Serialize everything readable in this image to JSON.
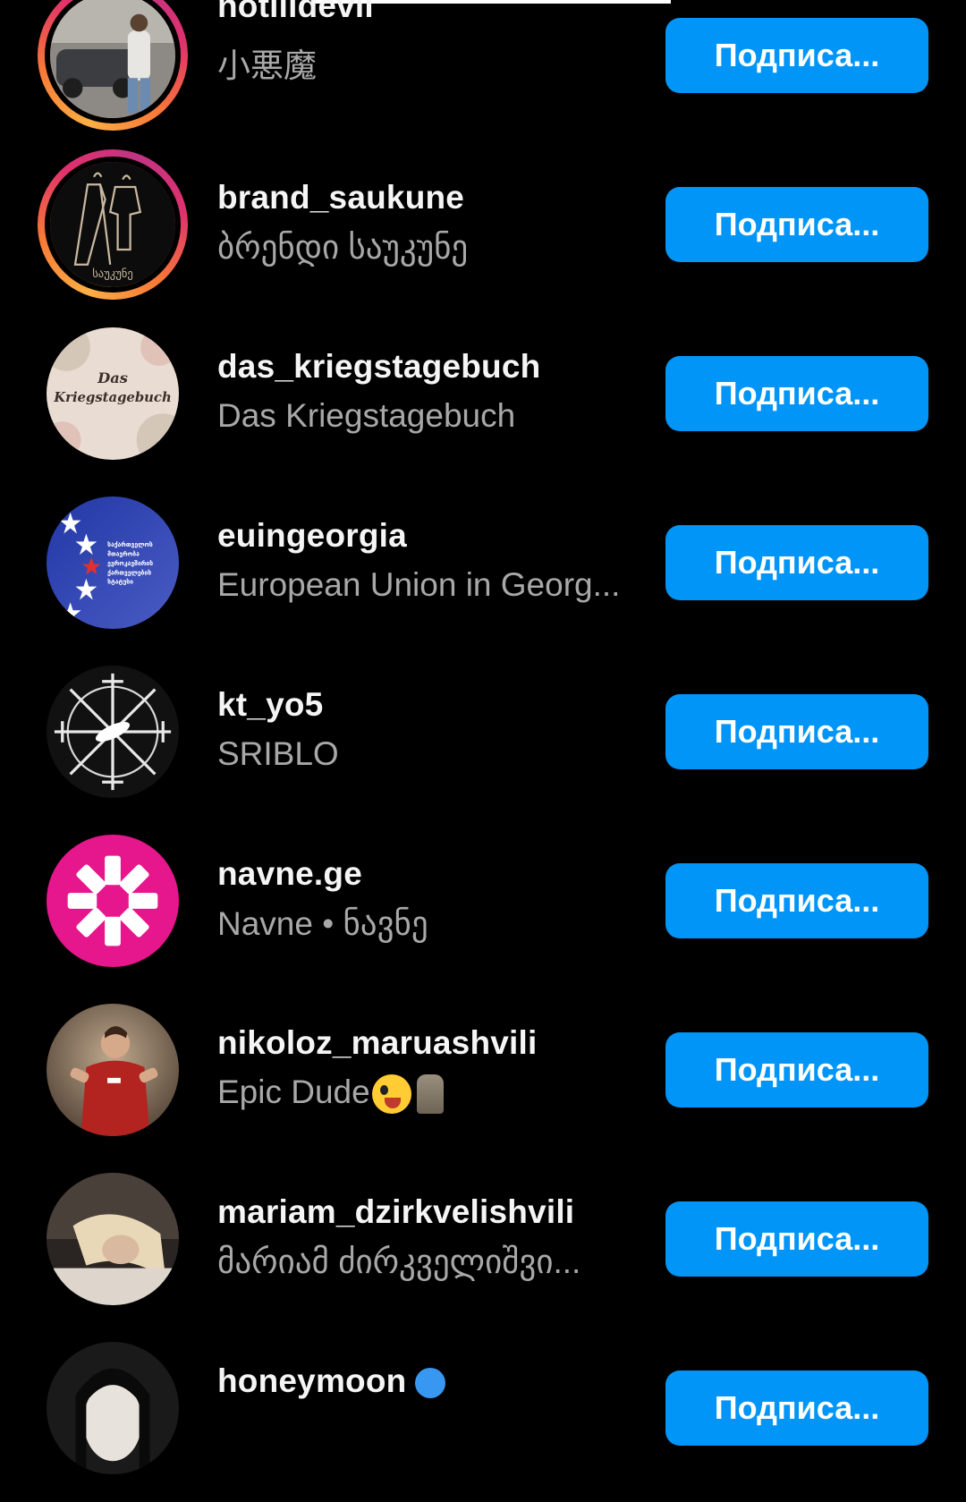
{
  "follow_list": {
    "items": [
      {
        "username": "notlildevil",
        "subtitle": "小悪魔",
        "button_label": "Подписа..."
      },
      {
        "username": "brand_saukune",
        "subtitle": "ბრენდი საუკუნე",
        "button_label": "Подписа..."
      },
      {
        "username": "das_kriegstagebuch",
        "subtitle": "Das Kriegstagebuch",
        "button_label": "Подписа..."
      },
      {
        "username": "euingeorgia",
        "subtitle": "European Union in Georg...",
        "button_label": "Подписа..."
      },
      {
        "username": "kt_yo5",
        "subtitle": "SRIBLO",
        "button_label": "Подписа..."
      },
      {
        "username": "navne.ge",
        "subtitle": "Navne • ნავნე",
        "button_label": "Подписа..."
      },
      {
        "username": "nikoloz_maruashvili",
        "subtitle": "Epic Dude",
        "button_label": "Подписа..."
      },
      {
        "username": "mariam_dzirkvelishvili",
        "subtitle": "მარიამ ძირკველიშვი...",
        "button_label": "Подписа..."
      },
      {
        "username": "honeymoon",
        "subtitle": "",
        "button_label": "Подписа..."
      }
    ],
    "avatar_texts": {
      "das_kriegstagebuch": {
        "line1": "Das",
        "line2": "Kriegstagebuch"
      },
      "brand_saukune": "საუკუნე",
      "euingeorgia": [
        "საქართველოს",
        "მთავრობა",
        "ევროკავშირის",
        "ქართველების",
        "სტატუსი"
      ]
    }
  },
  "colors": {
    "background": "#000000",
    "button": "#0095f6",
    "username": "#f5f5f5",
    "subtitle": "#a8a8a8",
    "navne_pink": "#e6168c",
    "eu_blue": "#2f47b0"
  },
  "icons": {
    "verified": "verified-badge-icon"
  }
}
